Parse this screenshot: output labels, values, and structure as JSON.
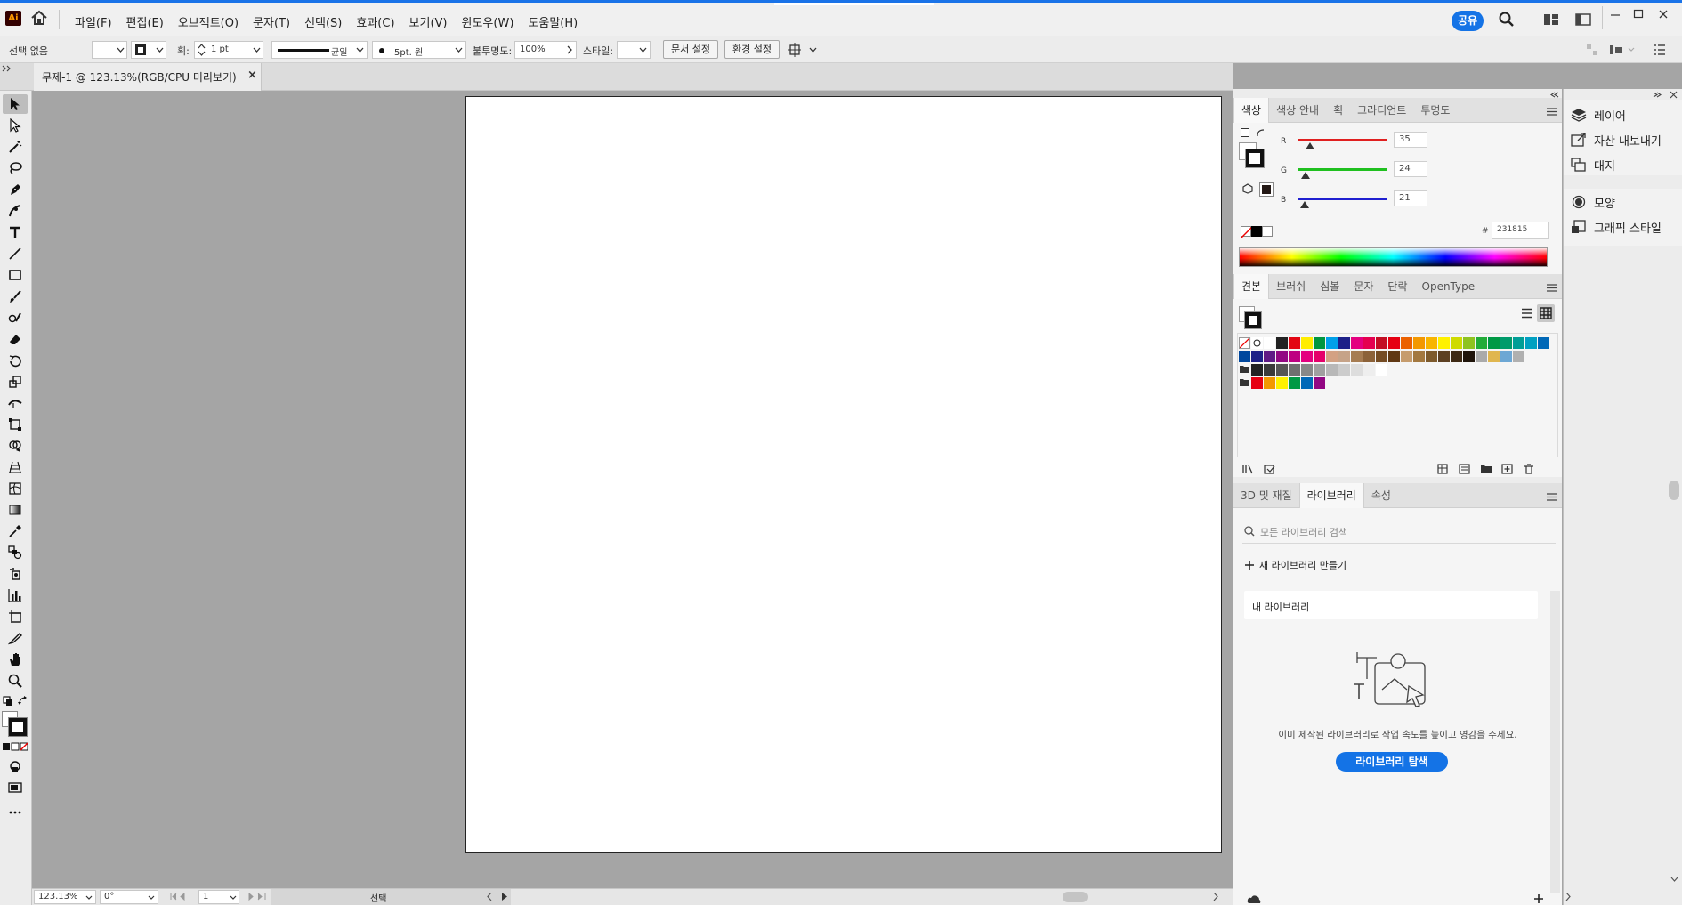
{
  "app": {
    "logo": "Ai",
    "home_icon": "home-icon"
  },
  "menu": [
    {
      "label": "파일(F)"
    },
    {
      "label": "편집(E)"
    },
    {
      "label": "오브젝트(O)"
    },
    {
      "label": "문자(T)"
    },
    {
      "label": "선택(S)"
    },
    {
      "label": "효과(C)"
    },
    {
      "label": "보기(V)"
    },
    {
      "label": "윈도우(W)"
    },
    {
      "label": "도움말(H)"
    }
  ],
  "topright": {
    "share": "공유"
  },
  "control": {
    "selection": "선택 없음",
    "stroke_label": "획:",
    "stroke_value": "1 pt",
    "profile": "균일",
    "brush": "5pt. 원",
    "opacity_label": "불투명도:",
    "opacity_value": "100%",
    "style_label": "스타일:",
    "doc_setup": "문서 설정",
    "prefs": "환경 설정"
  },
  "document": {
    "tab_title": "무제-1 @ 123.13%(RGB/CPU 미리보기)",
    "close": "×"
  },
  "status": {
    "zoom": "123.13%",
    "rotate": "0°",
    "page": "1",
    "mode": "선택"
  },
  "color_panel": {
    "tabs": [
      {
        "label": "색상"
      },
      {
        "label": "색상 안내"
      },
      {
        "label": "획"
      },
      {
        "label": "그라디언트"
      },
      {
        "label": "투명도"
      }
    ],
    "channels": [
      {
        "name": "R",
        "value": "35",
        "color": "#e02020"
      },
      {
        "name": "G",
        "value": "24",
        "color": "#20c020"
      },
      {
        "name": "B",
        "value": "21",
        "color": "#2020d0"
      }
    ],
    "hex_label": "#",
    "hex": "231815"
  },
  "swatches_panel": {
    "tabs": [
      {
        "label": "견본"
      },
      {
        "label": "브러쉬"
      },
      {
        "label": "심볼"
      },
      {
        "label": "문자"
      },
      {
        "label": "단락"
      },
      {
        "label": "OpenType"
      }
    ],
    "rows": [
      [
        "#ffffff",
        "#222222",
        "#e30613",
        "#ffed00",
        "#009640",
        "#00a0e9",
        "#1d2088",
        "#e4007f",
        "#e5004f",
        "#c30d23",
        "#e60012",
        "#eb6100",
        "#f39800",
        "#f8b500",
        "#fff100",
        "#cfdb00",
        "#8fc31f",
        "#22ac38",
        "#009944",
        "#009b6b",
        "#009e96",
        "#00a0c1",
        "#0068b7"
      ],
      [
        "#00479d",
        "#1d2088",
        "#601986",
        "#920783",
        "#be0081",
        "#e4007f",
        "#e5006a",
        "#d3a183",
        "#c6a388",
        "#a67c52",
        "#8c6239",
        "#754c24",
        "#603813",
        "#c69c6d",
        "#a3783f",
        "#7d5a2c",
        "#5c4022",
        "#3d2914",
        "#1f140a",
        "#aaaaaa",
        "#e0b64f",
        "#6da7d4",
        "#b0b0b0"
      ],
      [
        "#222222",
        "#3a3a3a",
        "#555555",
        "#6f6f6f",
        "#888888",
        "#a0a0a0",
        "#b8b8b8",
        "#cccccc",
        "#dddddd",
        "#eeeeee",
        "#ffffff"
      ],
      [
        "#e60012",
        "#f39800",
        "#fff100",
        "#009944",
        "#0068b7",
        "#920783"
      ]
    ]
  },
  "libraries_panel": {
    "tabs": [
      {
        "label": "3D 및 재질"
      },
      {
        "label": "라이브러리"
      },
      {
        "label": "속성"
      }
    ],
    "search_placeholder": "모든 라이브러리 검색",
    "new_library": "새 라이브러리 만들기",
    "my_library": "내 라이브러리",
    "empty_text": "이미 제작된 라이브러리로 작업 속도를 높이고 영감을 주세요.",
    "explore": "라이브러리 탐색"
  },
  "side_panels": [
    {
      "label": "레이어",
      "icon": "layers-icon"
    },
    {
      "label": "자산 내보내기",
      "icon": "export-assets-icon"
    },
    {
      "label": "대지",
      "icon": "artboards-icon"
    },
    {
      "label": "모양",
      "icon": "appearance-icon"
    },
    {
      "label": "그래픽 스타일",
      "icon": "graphic-styles-icon"
    }
  ]
}
